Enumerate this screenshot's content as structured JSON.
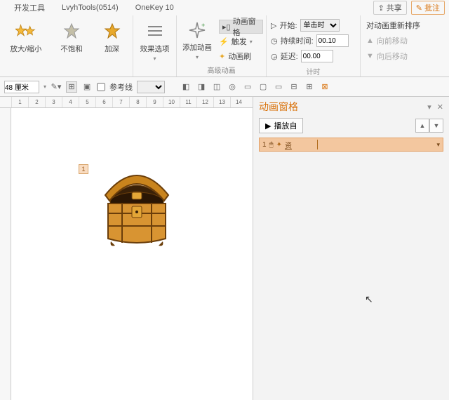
{
  "tabs": {
    "dev": "开发工具",
    "lvyh": "LvyhTools(0514)",
    "onekey": "OneKey 10"
  },
  "top_right": {
    "share": "共享",
    "annotate": "批注"
  },
  "ribbon": {
    "g1": {
      "zoom": "放大/缩小",
      "unsat": "不饱和",
      "deep": "加深"
    },
    "g2": {
      "effect": "效果选项"
    },
    "g3": {
      "add": "添加动画",
      "pane": "动画窗格",
      "trigger": "触发",
      "brush": "动画刷",
      "label": "高级动画"
    },
    "g4": {
      "start_lbl": "开始:",
      "start_val": "单击时",
      "duration_lbl": "持续时间:",
      "duration_val": "00.10",
      "delay_lbl": "延迟:",
      "delay_val": "00.00",
      "label": "计时"
    },
    "g5": {
      "reorder": "对动画重新排序",
      "earlier": "向前移动",
      "later": "向后移动"
    }
  },
  "quick": {
    "zoom_val": "48 厘米",
    "guide": "参考线"
  },
  "ruler": [
    "1",
    "2",
    "3",
    "4",
    "5",
    "6",
    "7",
    "8",
    "9",
    "10",
    "11",
    "12",
    "13",
    "14"
  ],
  "obj_tag": "1",
  "pane": {
    "title": "动画窗格",
    "play": "播放自",
    "item_num": "1",
    "item_name": "资"
  }
}
